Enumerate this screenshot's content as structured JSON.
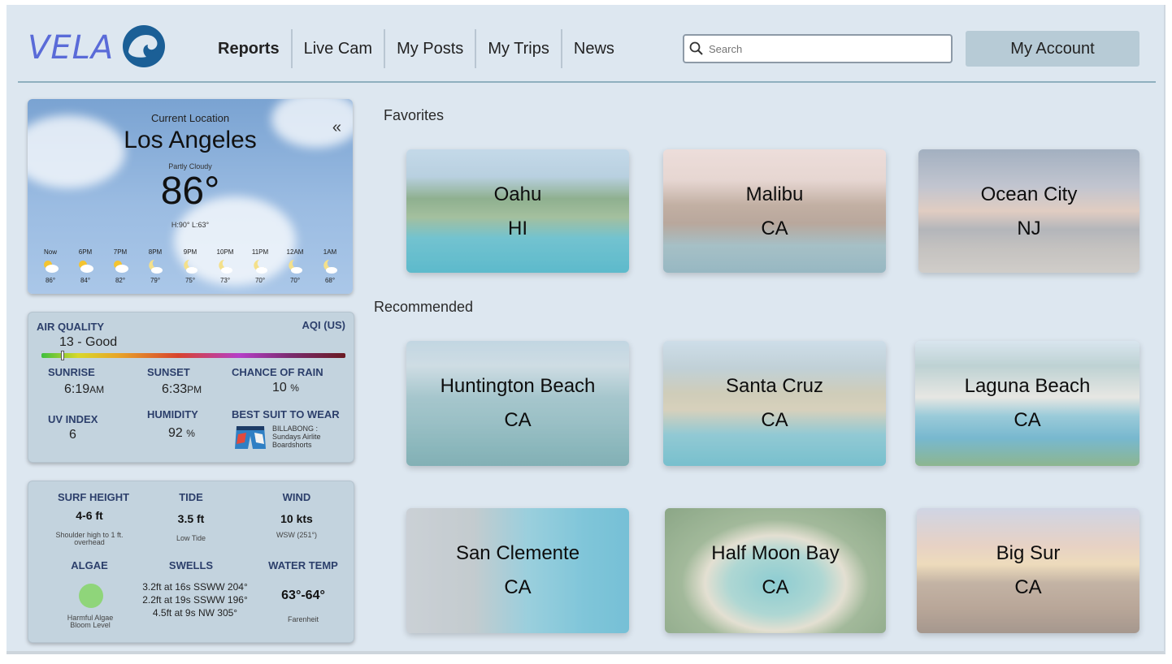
{
  "header": {
    "logo_text": "VELA",
    "nav": [
      "Reports",
      "Live Cam",
      "My Posts",
      "My Trips",
      "News"
    ],
    "search_placeholder": "Search",
    "account_label": "My Account"
  },
  "weather": {
    "location_label": "Current Location",
    "city": "Los Angeles",
    "condition": "Partly Cloudy",
    "temp": "86°",
    "hilo": "H:90°  L:63°",
    "hourly": [
      {
        "time": "Now",
        "icon": "sun-cloud-icon",
        "temp": "86°"
      },
      {
        "time": "6PM",
        "icon": "sun-cloud-icon",
        "temp": "84°"
      },
      {
        "time": "7PM",
        "icon": "sun-cloud-icon",
        "temp": "82°"
      },
      {
        "time": "8PM",
        "icon": "moon-cloud-icon",
        "temp": "79°"
      },
      {
        "time": "9PM",
        "icon": "moon-cloud-icon",
        "temp": "75°"
      },
      {
        "time": "10PM",
        "icon": "moon-cloud-icon",
        "temp": "73°"
      },
      {
        "time": "11PM",
        "icon": "moon-cloud-icon",
        "temp": "70°"
      },
      {
        "time": "12AM",
        "icon": "moon-cloud-icon",
        "temp": "70°"
      },
      {
        "time": "1AM",
        "icon": "moon-cloud-icon",
        "temp": "68°"
      }
    ]
  },
  "conditions": {
    "air_quality_label": "AIR QUALITY",
    "aqi_label": "AQI (US)",
    "aqi_value": "13 - Good",
    "aqi_fraction": 0.07,
    "sunrise_label": "SUNRISE",
    "sunrise_time": "6:19",
    "sunrise_suffix": "AM",
    "sunset_label": "SUNSET",
    "sunset_time": "6:33",
    "sunset_suffix": "PM",
    "rain_label": "CHANCE OF RAIN",
    "rain_value": "10",
    "rain_unit": "%",
    "uv_label": "UV INDEX",
    "uv_value": "6",
    "humidity_label": "HUMIDITY",
    "humidity_value": "92",
    "humidity_unit": "%",
    "suit_label": "BEST SUIT TO WEAR",
    "suit_name": "BILLABONG : Sundays Airlite Boardshorts"
  },
  "surf": {
    "height_label": "SURF HEIGHT",
    "height_value": "4-6 ft",
    "height_note": "Shoulder high to 1 ft. overhead",
    "tide_label": "TIDE",
    "tide_value": "3.5 ft",
    "tide_note": "Low Tide",
    "wind_label": "WIND",
    "wind_value": "10 kts",
    "wind_note": "WSW (251°)",
    "algae_label": "ALGAE",
    "algae_note": "Harmful Algae Bloom Level",
    "swells_label": "SWELLS",
    "swells": [
      "3.2ft at 16s SSWW 204°",
      "2.2ft at 19s SSWW 196°",
      "4.5ft at 9s NW 305°"
    ],
    "water_label": "WATER TEMP",
    "water_value": "63°-64°",
    "water_note": "Farenheit"
  },
  "favorites_title": "Favorites",
  "recommended_title": "Recommended",
  "favorites": [
    {
      "name": "Oahu",
      "state": "HI"
    },
    {
      "name": "Malibu",
      "state": "CA"
    },
    {
      "name": "Ocean City",
      "state": "NJ"
    }
  ],
  "recommended": [
    {
      "name": "Huntington Beach",
      "state": "CA"
    },
    {
      "name": "Santa Cruz",
      "state": "CA"
    },
    {
      "name": "Laguna Beach",
      "state": "CA"
    },
    {
      "name": "San Clemente",
      "state": "CA"
    },
    {
      "name": "Half Moon Bay",
      "state": "CA"
    },
    {
      "name": "Big Sur",
      "state": "CA"
    }
  ]
}
